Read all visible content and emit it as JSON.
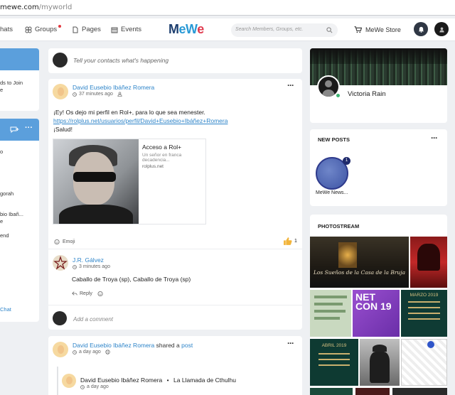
{
  "url": {
    "domain": "mewe.com",
    "path": "/myworld"
  },
  "topnav": {
    "chats_label": "hats",
    "groups_label": "Groups",
    "pages_label": "Pages",
    "events_label": "Events",
    "logo": [
      "M",
      "e",
      "W",
      "e"
    ],
    "logo_colors": [
      "#1d3e6e",
      "#2a9ad6",
      "#2a9ad6",
      "#e03b4f"
    ],
    "search_placeholder": "Search Members, Groups, etc.",
    "store_label": "MeWe Store"
  },
  "left": {
    "card1_text": "ds to Join",
    "card1_text2": "e",
    "items": [
      "o",
      "gorah",
      "bio Ibañ...",
      "e",
      "end"
    ],
    "chat_label": "Chat"
  },
  "composer": {
    "placeholder": "Tell your contacts what's happening"
  },
  "post1": {
    "author": "David Eusebio Ibáñez Romera",
    "time": "37 minutes ago",
    "line1": "¡Ey! Os dejo mi perfil en Rol+, para lo que sea menester.",
    "link": "https://rolplus.net/usuarios/perfil/David+Eusebio+Ibáñez+Romera",
    "line3": "¡Salud!",
    "preview_title": "Acceso a Rol+",
    "preview_desc": "Un señor en franca decadencia...",
    "preview_domain": "rolplus.net",
    "emoji_label": "Emoji",
    "like_count": "1"
  },
  "comment": {
    "author": "J.R. Gálvez",
    "time": "3 minutes ago",
    "text": "Caballo de Troya (sp), Caballo de Troya (sp)",
    "reply_label": "Reply",
    "add_placeholder": "Add a comment"
  },
  "post2": {
    "author": "David Eusebio Ibáñez Romera",
    "shared": "shared a",
    "shared_link": "post",
    "time": "a day ago",
    "inner_author": "David Eusebio Ibáñez Romera",
    "inner_sep": "•",
    "inner_target": "La Llamada de Cthulhu",
    "inner_time": "a day ago"
  },
  "profile": {
    "name": "Victoria Rain",
    "online_color": "#3cb371"
  },
  "new_posts": {
    "title": "NEW POSTS",
    "item_label": "MeWe News...",
    "badge": "1"
  },
  "photostream": {
    "title": "PHOTOSTREAM",
    "caption1": "Los Sueños de la Casa de la Bruja",
    "caption2": "NET CON 19",
    "caption3": "MARZO 2019",
    "caption4": "ABRIL 2019"
  }
}
